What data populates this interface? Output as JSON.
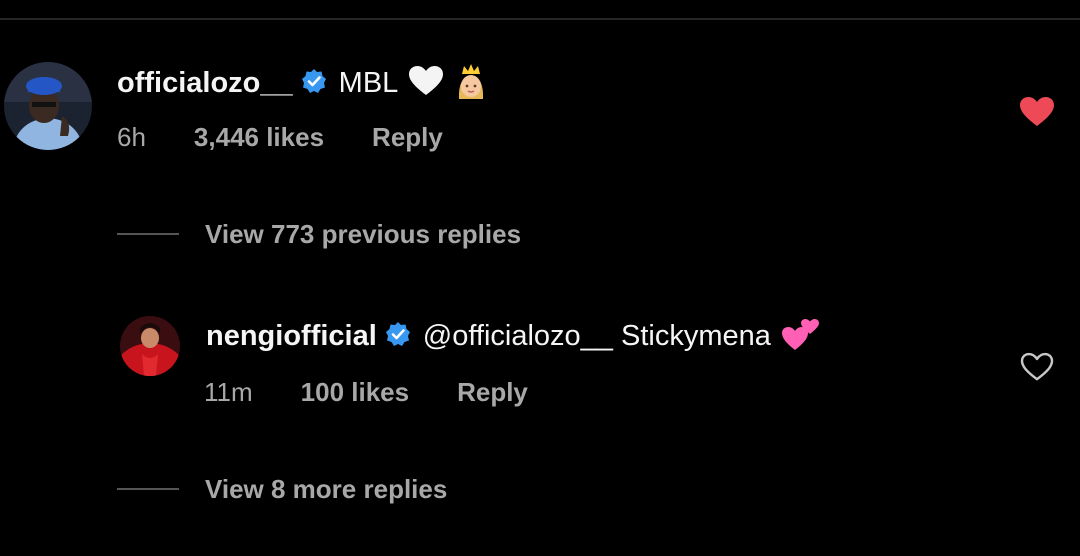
{
  "comment1": {
    "username": "officialozo__",
    "text": "MBL",
    "emojis": [
      "white-heart",
      "princess"
    ],
    "time": "6h",
    "likes": "3,446 likes",
    "reply": "Reply",
    "liked": true,
    "heart_color": "#ed4956"
  },
  "view_previous": "View 773 previous replies",
  "comment2": {
    "username": "nengiofficial",
    "text": "@officialozo__ Stickymena",
    "emojis": [
      "two-hearts"
    ],
    "time": "11m",
    "likes": "100 likes",
    "reply": "Reply",
    "liked": false
  },
  "view_more": "View 8 more replies",
  "colors": {
    "background": "#000000",
    "text": "#f5f5f5",
    "muted": "#a8a8a8",
    "verified": "#3897f0"
  }
}
